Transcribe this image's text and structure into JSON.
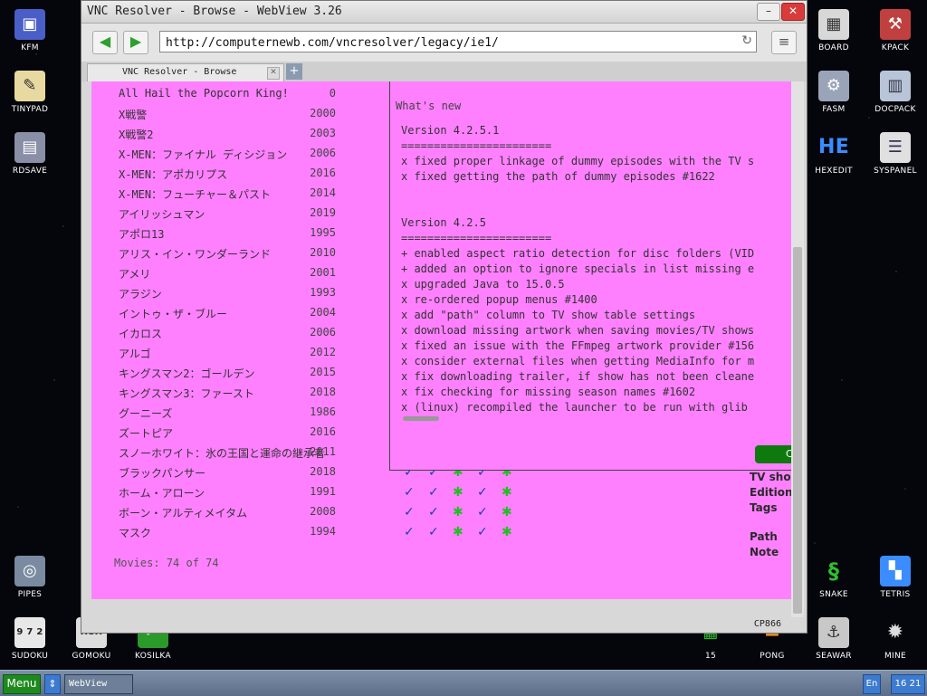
{
  "desktop": {
    "icons_left": [
      {
        "label": "KFM",
        "icon": "floppy-disk-icon"
      },
      {
        "label": "TINYPAD",
        "icon": "notepad-icon"
      },
      {
        "label": "RDSAVE",
        "icon": "save-icon"
      },
      {
        "label": "PIPES",
        "icon": "pipes-game-icon"
      },
      {
        "label": "SUDOKU",
        "icon": "sudoku-icon"
      },
      {
        "label": "GOMOKU",
        "icon": "gomoku-icon"
      },
      {
        "label": "KOSILKA",
        "icon": "lawnmower-icon"
      }
    ],
    "icons_right": [
      {
        "label": "BOARD",
        "icon": "board-icon"
      },
      {
        "label": "KPACK",
        "icon": "hammer-icon"
      },
      {
        "label": "FASM",
        "icon": "fasm-icon"
      },
      {
        "label": "DOCPACK",
        "icon": "docpack-icon"
      },
      {
        "label": "HEXEDIT",
        "icon": "hexedit-icon",
        "glyph": "HE"
      },
      {
        "label": "SYSPANEL",
        "icon": "sliders-icon"
      },
      {
        "label": "SNAKE",
        "icon": "snake-icon"
      },
      {
        "label": "TETRIS",
        "icon": "tetris-icon"
      },
      {
        "label": "15",
        "icon": "fifteen-puzzle-icon"
      },
      {
        "label": "PONG",
        "icon": "pong-icon"
      },
      {
        "label": "SEAWAR",
        "icon": "seawar-icon"
      },
      {
        "label": "MINE",
        "icon": "mine-icon"
      }
    ]
  },
  "window": {
    "title": "VNC Resolver - Browse - WebView 3.26",
    "url": "http://computernewb.com/vncresolver/legacy/ie1/",
    "tab_label": "VNC Resolver - Browse",
    "new_tab": "+",
    "encoding": "CP866"
  },
  "movies": [
    {
      "title": "All Hail the Popcorn King!",
      "year": "0"
    },
    {
      "title": "X戦警",
      "year": "2000"
    },
    {
      "title": "X戦警2",
      "year": "2003"
    },
    {
      "title": "X-MEN：ファイナル ディシジョン",
      "year": "2006"
    },
    {
      "title": "X-MEN：アポカリプス",
      "year": "2016"
    },
    {
      "title": "X-MEN：フューチャー＆パスト",
      "year": "2014"
    },
    {
      "title": "アイリッシュマン",
      "year": "2019"
    },
    {
      "title": "アポロ13",
      "year": "1995"
    },
    {
      "title": "アリス・イン・ワンダーランド",
      "year": "2010"
    },
    {
      "title": "アメリ",
      "year": "2001"
    },
    {
      "title": "アラジン",
      "year": "1993"
    },
    {
      "title": "イントゥ・ザ・ブルー",
      "year": "2004"
    },
    {
      "title": "イカロス",
      "year": "2006"
    },
    {
      "title": "アルゴ",
      "year": "2012"
    },
    {
      "title": "キングスマン2：ゴールデン",
      "year": "2015"
    },
    {
      "title": "キングスマン3：ファースト",
      "year": "2018"
    },
    {
      "title": "グーニーズ",
      "year": "1986"
    },
    {
      "title": "ズートピア",
      "year": "2016"
    },
    {
      "title": "スノーホワイト：氷の王国と運命の継承者",
      "year": "2011"
    },
    {
      "title": "ブラックパンサー",
      "year": "2018"
    },
    {
      "title": "ホーム・アローン",
      "year": "1991"
    },
    {
      "title": "ボーン・アルティメイタム",
      "year": "2008"
    },
    {
      "title": "マスク",
      "year": "1994"
    }
  ],
  "movies_count": "Movies: 74 of 74",
  "check_glyph": "✓",
  "star_glyph": "✱",
  "side_labels": [
    "TV sho",
    "Edition",
    "Tags",
    "Path",
    "Note"
  ],
  "dialog": {
    "heading": "What's new",
    "notes": [
      "Version 4.2.5.1",
      "=======================",
      "x fixed proper linkage of dummy episodes with the TV s",
      "x fixed getting the path of dummy episodes #1622",
      "",
      "",
      "Version 4.2.5",
      "=======================",
      "+ enabled aspect ratio detection for disc folders (VID",
      "+ added an option to ignore specials in list missing e",
      "x upgraded Java to 15.0.5",
      "x re-ordered popup menus #1400",
      "x add \"path\" column to TV show table settings",
      "x download missing artwork when saving movies/TV shows",
      "x fixed an issue with the FFmpeg artwork provider #156",
      "x consider external files when getting MediaInfo for m",
      "x fix downloading trailer, if show has not been cleane",
      "x fix checking for missing season names #1602",
      "x (linux) recompiled the launcher to be run with glib"
    ],
    "ok_label": "C"
  },
  "taskbar": {
    "menu_label": "Menu",
    "arrows": "⇕",
    "task_label": "WebView",
    "lang": "En",
    "clock": "16 21"
  }
}
